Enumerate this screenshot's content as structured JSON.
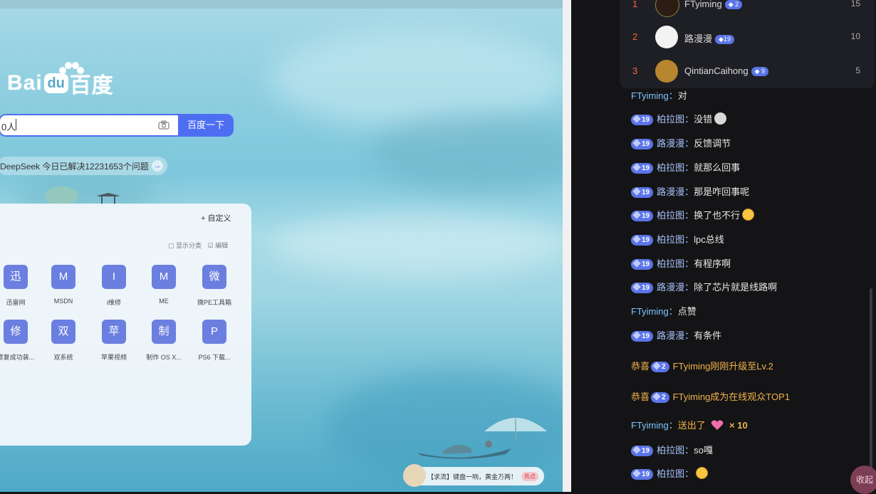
{
  "browser": {
    "logo": {
      "left": "Bai",
      "middle": "du",
      "right": "百度"
    },
    "search": {
      "value": "0人",
      "button": "百度一下"
    },
    "banner": "DeepSeek 今日已解决12231653个问题",
    "card": {
      "custom": "+ 自定义",
      "options": [
        "▢ 显示分类",
        "☑ 编辑"
      ],
      "tiles": [
        {
          "icon": "迅",
          "label": "迅雷网"
        },
        {
          "icon": "M",
          "label": "MSDN"
        },
        {
          "icon": "I",
          "label": "i维修"
        },
        {
          "icon": "M",
          "label": "ME"
        },
        {
          "icon": "微",
          "label": "微PE工具箱"
        },
        {
          "icon": "修",
          "label": "修复成功装..."
        },
        {
          "icon": "双",
          "label": "双系统"
        },
        {
          "icon": "苹",
          "label": "苹果视频"
        },
        {
          "icon": "制",
          "label": "制作 OS X..."
        },
        {
          "icon": "P",
          "label": "PS6 下载..."
        }
      ]
    },
    "ticker": {
      "text": "【求流】键盘一响，黄金万两！",
      "tag": "热点"
    }
  },
  "chat": {
    "ranking": [
      {
        "rank": "1",
        "name": "FTyiming",
        "level": "2",
        "count": "15"
      },
      {
        "rank": "2",
        "name": "路漫漫",
        "level": "19",
        "count": "10"
      },
      {
        "rank": "3",
        "name": "QintianCaihong",
        "level": "9",
        "count": "5"
      }
    ],
    "messages": [
      {
        "user": "FTyiming",
        "level": "",
        "text": "对"
      },
      {
        "user": "柏拉图",
        "level": "19",
        "text": "没错"
      },
      {
        "user": "路漫漫",
        "level": "19",
        "text": "反馈调节"
      },
      {
        "user": "柏拉图",
        "level": "19",
        "text": "就那么回事"
      },
      {
        "user": "路漫漫",
        "level": "19",
        "text": "那是咋回事呢"
      },
      {
        "user": "柏拉图",
        "level": "19",
        "text": "换了也不行"
      },
      {
        "user": "柏拉图",
        "level": "19",
        "text": "lpc总线"
      },
      {
        "user": "柏拉图",
        "level": "19",
        "text": "有程序啊"
      },
      {
        "user": "路漫漫",
        "level": "19",
        "text": "除了芯片就是线路啊"
      },
      {
        "user": "FTyiming",
        "level": "",
        "text": "点赞"
      },
      {
        "user": "路漫漫",
        "level": "19",
        "text": "有条件"
      },
      {
        "user": "柏拉图",
        "level": "19",
        "text": "so嘎"
      },
      {
        "user": "柏拉图",
        "level": "19",
        "text": ""
      }
    ],
    "colon": "：",
    "system": [
      {
        "prefix": "恭喜",
        "level": "2",
        "text": "FTyiming刚刚升级至Lv.2"
      },
      {
        "prefix": "恭喜",
        "level": "2",
        "text": "FTyiming成为在线观众TOP1"
      }
    ],
    "gift": {
      "user": "FTyiming",
      "sent": "送出了",
      "count": "× 10"
    },
    "float_button": "收起"
  }
}
